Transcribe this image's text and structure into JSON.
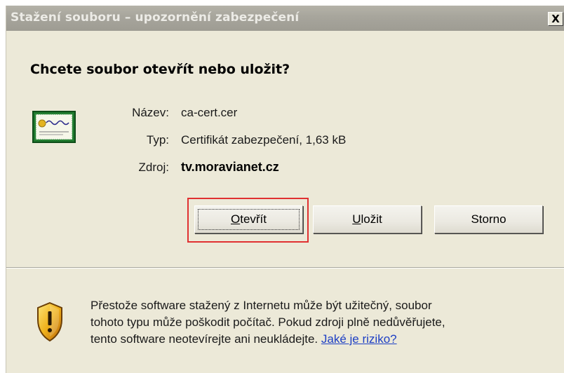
{
  "window": {
    "title": "Stažení souboru – upozornění zabezpečení",
    "close_label": "X"
  },
  "dialog": {
    "question": "Chcete soubor otevřít nebo uložit?",
    "file_icon": "certificate-icon",
    "fields": {
      "name_label": "Název:",
      "name_value": "ca-cert.cer",
      "type_label": "Typ:",
      "type_value": "Certifikát zabezpečení, 1,63 kB",
      "source_label": "Zdroj:",
      "source_value": "tv.moravianet.cz"
    },
    "buttons": {
      "open": {
        "prefix": "",
        "accel": "O",
        "rest": "tevřít"
      },
      "save": {
        "prefix": "",
        "accel": "U",
        "rest": "ložit"
      },
      "cancel": {
        "label": "Storno"
      }
    },
    "highlight_color": "#e03131"
  },
  "warning": {
    "icon": "security-shield-icon",
    "line1": "Přestože software stažený z Internetu může být užitečný, soubor",
    "line2": "tohoto typu může poškodit počítač. Pokud zdroji plně nedůvěřujete,",
    "line3_text": "tento software neotevírejte ani neukládejte.",
    "link": "Jaké je riziko?",
    "link_color": "#1d3fc4"
  }
}
